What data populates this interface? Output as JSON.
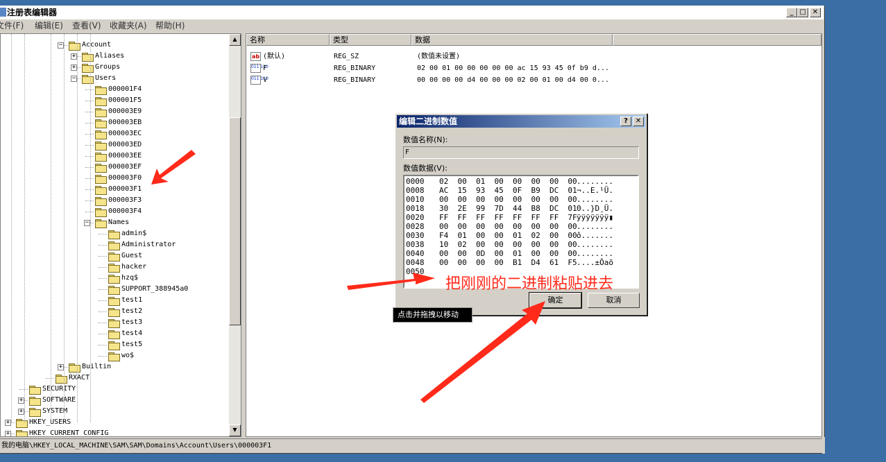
{
  "window": {
    "title": "注册表编辑器",
    "min_label": "_",
    "max_label": "□",
    "close_label": "✕"
  },
  "menu": [
    "文件(F)",
    "编辑(E)",
    "查看(V)",
    "收藏夹(A)",
    "帮助(H)"
  ],
  "tree": [
    {
      "label": "Account",
      "depth": 5,
      "expander": "minus"
    },
    {
      "label": "Aliases",
      "depth": 6,
      "expander": "plus"
    },
    {
      "label": "Groups",
      "depth": 6,
      "expander": "plus"
    },
    {
      "label": "Users",
      "depth": 6,
      "expander": "minus"
    },
    {
      "label": "000001F4",
      "depth": 7
    },
    {
      "label": "000001F5",
      "depth": 7
    },
    {
      "label": "000003E9",
      "depth": 7
    },
    {
      "label": "000003EB",
      "depth": 7
    },
    {
      "label": "000003EC",
      "depth": 7
    },
    {
      "label": "000003ED",
      "depth": 7
    },
    {
      "label": "000003EE",
      "depth": 7
    },
    {
      "label": "000003EF",
      "depth": 7
    },
    {
      "label": "000003F0",
      "depth": 7
    },
    {
      "label": "000003F1",
      "depth": 7,
      "selected": true
    },
    {
      "label": "000003F3",
      "depth": 7
    },
    {
      "label": "000003F4",
      "depth": 7
    },
    {
      "label": "Names",
      "depth": 7,
      "expander": "minus"
    },
    {
      "label": "admin$",
      "depth": 8
    },
    {
      "label": "Administrator",
      "depth": 8
    },
    {
      "label": "Guest",
      "depth": 8
    },
    {
      "label": "hacker",
      "depth": 8
    },
    {
      "label": "hzq$",
      "depth": 8
    },
    {
      "label": "SUPPORT_388945a0",
      "depth": 8
    },
    {
      "label": "test1",
      "depth": 8
    },
    {
      "label": "test2",
      "depth": 8
    },
    {
      "label": "test3",
      "depth": 8
    },
    {
      "label": "test4",
      "depth": 8
    },
    {
      "label": "test5",
      "depth": 8
    },
    {
      "label": "wo$",
      "depth": 8
    },
    {
      "label": "Builtin",
      "depth": 5,
      "expander": "plus"
    },
    {
      "label": "RXACT",
      "depth": 4
    },
    {
      "label": "SECURITY",
      "depth": 2
    },
    {
      "label": "SOFTWARE",
      "depth": 2,
      "expander": "plus"
    },
    {
      "label": "SYSTEM",
      "depth": 2,
      "expander": "plus"
    },
    {
      "label": "HKEY_USERS",
      "depth": 1,
      "expander": "plus"
    },
    {
      "label": "HKEY_CURRENT_CONFIG",
      "depth": 1,
      "expander": "plus"
    }
  ],
  "list": {
    "columns": [
      "名称",
      "类型",
      "数据"
    ],
    "rows": [
      {
        "icon": "string-value-icon",
        "icon_text": "ab",
        "name": "(默认)",
        "type": "REG_SZ",
        "data": "(数值未设置)"
      },
      {
        "icon": "binary-value-icon",
        "icon_text": "011 110",
        "name": "F",
        "type": "REG_BINARY",
        "data": "02 00 01 00 00 00 00 00 ac 15 93 45 0f b9 d..."
      },
      {
        "icon": "binary-value-icon",
        "icon_text": "011 110",
        "name": "V",
        "type": "REG_BINARY",
        "data": "00 00 00 00 d4 00 00 00 02 00 01 00 d4 00 0..."
      }
    ]
  },
  "status": "我的电脑\\HKEY_LOCAL_MACHINE\\SAM\\SAM\\Domains\\Account\\Users\\000003F1",
  "dialog": {
    "title": "编辑二进制数值",
    "help_label": "?",
    "close_label": "✕",
    "name_label": "数值名称(N):",
    "name_value": "F",
    "data_label": "数值数据(V):",
    "hex_rows": [
      {
        "addr": "0000",
        "bytes": "02  00  01  00  00  00  00  00",
        "ascii": "........"
      },
      {
        "addr": "0008",
        "bytes": "AC  15  93  45  0F  B9  DC  01",
        "ascii": "¬..E.¹Ü."
      },
      {
        "addr": "0010",
        "bytes": "00  00  00  00  00  00  00  00",
        "ascii": "........"
      },
      {
        "addr": "0018",
        "bytes": "30  2E  99  7D  44  B8  DC  01",
        "ascii": "0..}D¸Ü."
      },
      {
        "addr": "0020",
        "bytes": "FF  FF  FF  FF  FF  FF  FF  7F",
        "ascii": "ÿÿÿÿÿÿÿ▮"
      },
      {
        "addr": "0028",
        "bytes": "00  00  00  00  00  00  00  00",
        "ascii": "........"
      },
      {
        "addr": "0030",
        "bytes": "F4  01  00  00  01  02  00  00",
        "ascii": "ô......."
      },
      {
        "addr": "0038",
        "bytes": "10  02  00  00  00  00  00  00",
        "ascii": "........"
      },
      {
        "addr": "0040",
        "bytes": "00  00  0D  00  01  00  00  00",
        "ascii": "........"
      },
      {
        "addr": "0048",
        "bytes": "00  00  00  00  B1  D4  61  F5",
        "ascii": "....±Ôaõ"
      },
      {
        "addr": "0050",
        "bytes": "",
        "ascii": ""
      }
    ],
    "ok_label": "确定",
    "cancel_label": "取消"
  },
  "tooltip": "点击并拖拽以移动",
  "annotation": {
    "text": "把刚刚的二进制粘贴进去",
    "color": "#ff2a1a"
  }
}
